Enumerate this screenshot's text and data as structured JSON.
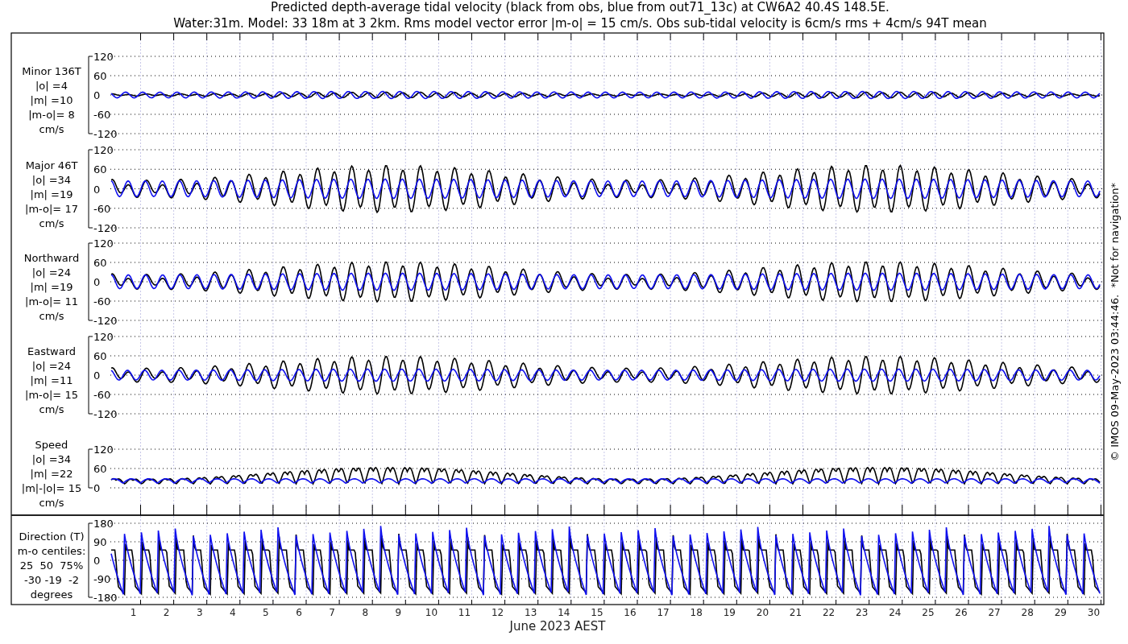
{
  "title_lines": [
    "Predicted depth-average tidal velocity (black from obs, blue from out71_13c) at CW6A2 40.4S 148.5E.",
    "Water:31m. Model: 33 18m at 3 2km. Rms model vector error |m-o| = 15 cm/s. Obs sub-tidal velocity is 6cm/s rms + 4cm/s 94T mean"
  ],
  "panels": [
    {
      "kind": "velocity",
      "label_lines": [
        "Minor 136T",
        "|o| =4",
        "|m| =10",
        "|m-o|= 8",
        "cm/s"
      ],
      "yticks": [
        "120",
        "60",
        "0",
        "-60",
        "-120"
      ]
    },
    {
      "kind": "velocity",
      "label_lines": [
        "Major 46T",
        "|o| =34",
        "|m| =19",
        "|m-o|= 17",
        "cm/s"
      ],
      "yticks": [
        "120",
        "60",
        "0",
        "-60",
        "-120"
      ]
    },
    {
      "kind": "velocity",
      "label_lines": [
        "Northward",
        "|o| =24",
        "|m| =19",
        "|m-o|= 11",
        "cm/s"
      ],
      "yticks": [
        "120",
        "60",
        "0",
        "-60",
        "-120"
      ]
    },
    {
      "kind": "velocity",
      "label_lines": [
        "Eastward",
        "|o| =24",
        "|m| =11",
        "|m-o|= 15",
        "cm/s"
      ],
      "yticks": [
        "120",
        "60",
        "0",
        "-60",
        "-120"
      ]
    },
    {
      "kind": "speed",
      "label_lines": [
        "Speed",
        "|o| =34",
        "|m| =22",
        "|m|-|o|= 15",
        "cm/s"
      ],
      "yticks": [
        "120",
        "60",
        "0"
      ]
    },
    {
      "kind": "direction",
      "label_lines": [
        "Direction (T)",
        "m-o centiles:",
        "25  50  75%",
        "-30 -19  -2",
        "degrees"
      ],
      "yticks": [
        "180",
        "90",
        "0",
        "-90",
        "-180"
      ]
    }
  ],
  "x_axis": {
    "ticks": [
      "1",
      "2",
      "3",
      "4",
      "5",
      "6",
      "7",
      "8",
      "9",
      "10",
      "11",
      "12",
      "13",
      "14",
      "15",
      "16",
      "17",
      "18",
      "19",
      "20",
      "21",
      "22",
      "23",
      "24",
      "25",
      "26",
      "27",
      "28",
      "29",
      "30"
    ],
    "label": "June 2023 AEST"
  },
  "footer": "© IMOS 09-May-2023 03:44:46.  *Not for navigation*"
}
